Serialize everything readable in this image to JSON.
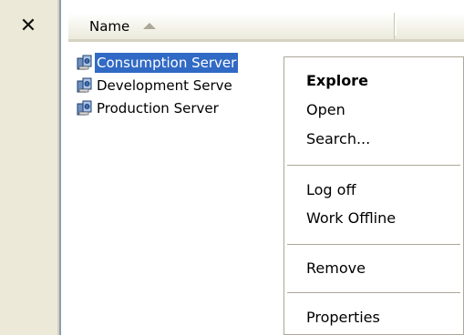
{
  "toolbar": {
    "close_label": "✕"
  },
  "list": {
    "header": {
      "name": "Name",
      "sort_icon": "sort-ascending-icon"
    },
    "items": [
      {
        "label": "Consumption Server",
        "icon": "server-icon",
        "selected": true
      },
      {
        "label": "Development Serve",
        "icon": "server-icon",
        "selected": false
      },
      {
        "label": "Production Server",
        "icon": "server-icon",
        "selected": false
      }
    ]
  },
  "context_menu": {
    "items": [
      {
        "label": "Explore",
        "default": true
      },
      {
        "label": "Open"
      },
      {
        "label": "Search..."
      },
      {
        "label": "Log off"
      },
      {
        "label": "Work Offline"
      },
      {
        "label": "Remove"
      },
      {
        "label": "Properties"
      }
    ]
  },
  "colors": {
    "selection": "#316ac5",
    "pane": "#ece9d8",
    "menu_border": "#aca899"
  }
}
